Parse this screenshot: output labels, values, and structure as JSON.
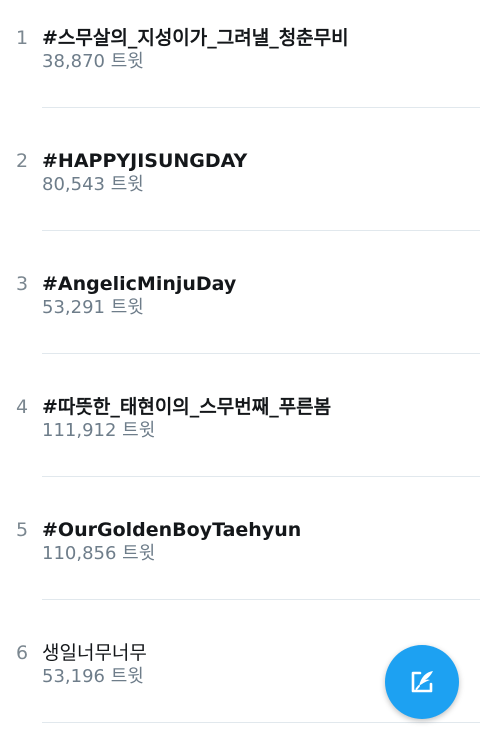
{
  "trends": [
    {
      "rank": "1",
      "name": "#스무살의_지성이가_그려낼_청춘무비",
      "count": "38,870 트윗"
    },
    {
      "rank": "2",
      "name": "#HAPPYJISUNGDAY",
      "count": "80,543 트윗"
    },
    {
      "rank": "3",
      "name": "#AngelicMinjuDay",
      "count": "53,291 트윗"
    },
    {
      "rank": "4",
      "name": "#따뜻한_태현이의_스무번째_푸른봄",
      "count": "111,912 트윗"
    },
    {
      "rank": "5",
      "name": "#OurGoldenBoyTaehyun",
      "count": "110,856 트윗"
    },
    {
      "rank": "6",
      "name": "생일너무너무",
      "count": "53,196 트윗"
    }
  ],
  "compose_button": {
    "icon": "compose-tweet-icon",
    "color": "#1da1f2"
  }
}
